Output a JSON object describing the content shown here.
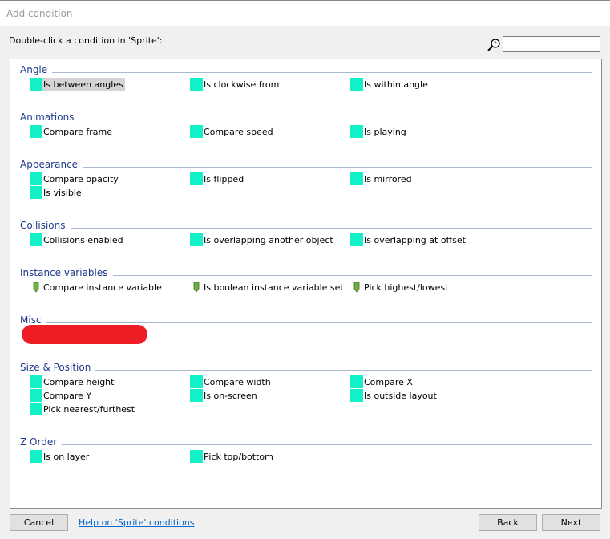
{
  "window": {
    "title": "Add condition"
  },
  "header": {
    "instruction": "Double-click a condition in 'Sprite':",
    "search_icon": "magnifier-icon",
    "search_value": ""
  },
  "colors": {
    "condition_icon": "#14f0c8",
    "variable_icon": "#6db33f",
    "section_title": "#1e3a8a",
    "redaction": "#ee1c25",
    "link": "#0066cc"
  },
  "sections": [
    {
      "title": "Angle",
      "items": [
        "Is between angles",
        "Is clockwise from",
        "Is within angle"
      ]
    },
    {
      "title": "Animations",
      "items": [
        "Compare frame",
        "Compare speed",
        "Is playing"
      ]
    },
    {
      "title": "Appearance",
      "items": [
        "Compare opacity",
        "Is flipped",
        "Is mirrored",
        "Is visible"
      ]
    },
    {
      "title": "Collisions",
      "items": [
        "Collisions enabled",
        "Is overlapping another object",
        "Is overlapping at offset"
      ]
    },
    {
      "title": "Instance variables",
      "items": [
        "Compare instance variable",
        "Is boolean instance variable set",
        "Pick highest/lowest"
      ]
    },
    {
      "title": "Misc",
      "items": []
    },
    {
      "title": "Size & Position",
      "items": [
        "Compare height",
        "Compare width",
        "Compare X",
        "Compare Y",
        "Is on-screen",
        "Is outside layout",
        "Pick nearest/furthest"
      ]
    },
    {
      "title": "Z Order",
      "items": [
        "Is on layer",
        "Pick top/bottom"
      ]
    }
  ],
  "selected_item": "Is between angles",
  "footer": {
    "cancel": "Cancel",
    "help": "Help on 'Sprite' conditions",
    "back": "Back",
    "next": "Next"
  }
}
